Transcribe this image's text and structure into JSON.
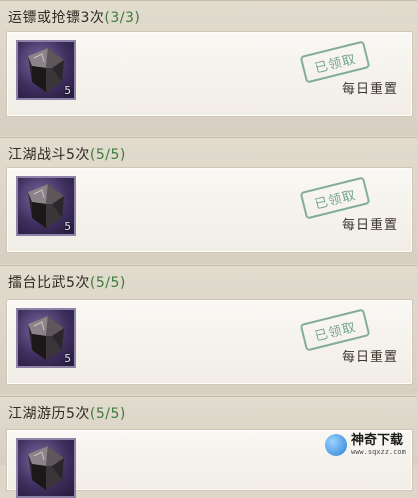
{
  "tasks": [
    {
      "title": "运镖或抢镖3次",
      "progress": "(3/3)",
      "item_count": "5",
      "stamp": "已领取",
      "reset": "每日重置",
      "item_icon": "dark-crystal-icon"
    },
    {
      "title": "江湖战斗5次",
      "progress": "(5/5)",
      "item_count": "5",
      "stamp": "已领取",
      "reset": "每日重置",
      "item_icon": "dark-crystal-icon"
    },
    {
      "title": "擂台比武5次",
      "progress": "(5/5)",
      "item_count": "5",
      "stamp": "已领取",
      "reset": "每日重置",
      "item_icon": "dark-crystal-icon"
    },
    {
      "title": "江湖游历5次",
      "progress": "(5/5)",
      "item_icon": "dark-crystal-icon"
    }
  ],
  "watermark": {
    "name": "神奇下载",
    "url": "www.sqxzz.com"
  },
  "colors": {
    "progress_green": "#3d7a3a",
    "stamp_green": "#5e987b",
    "item_purple": "#3e2f5e"
  }
}
